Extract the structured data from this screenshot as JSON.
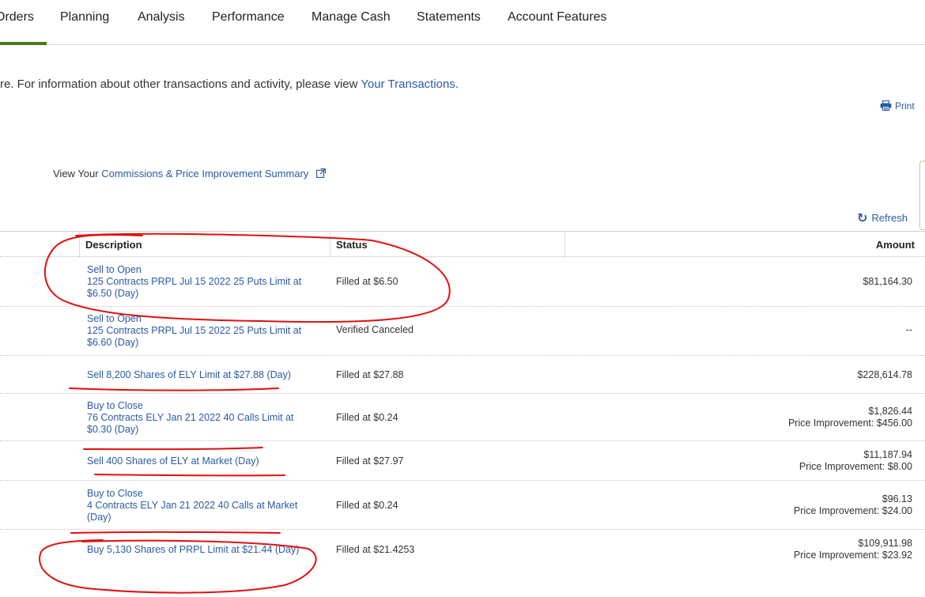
{
  "nav": {
    "items": [
      "Orders",
      "Planning",
      "Analysis",
      "Performance",
      "Manage Cash",
      "Statements",
      "Account Features"
    ],
    "active": "Orders"
  },
  "info": {
    "text": "re. For information about other transactions and activity, please view ",
    "link": "Your Transactions."
  },
  "print_label": "Print",
  "commissions": {
    "prefix": "View Your ",
    "link": "Commissions & Price Improvement Summary"
  },
  "refresh_label": "Refresh",
  "table": {
    "headers": {
      "description": "Description",
      "status": "Status",
      "amount": "Amount"
    },
    "rows": [
      {
        "desc": [
          "Sell to Open",
          "125 Contracts PRPL Jul 15 2022 25 Puts Limit at",
          "$6.50 (Day)"
        ],
        "status": "Filled at $6.50",
        "amount": "$81,164.30",
        "price_improvement": ""
      },
      {
        "desc": [
          "Sell to Open",
          "125 Contracts PRPL Jul 15 2022 25 Puts Limit at",
          "$6.60 (Day)"
        ],
        "status": "Verified Canceled",
        "amount": "--",
        "price_improvement": ""
      },
      {
        "desc": [
          "Sell 8,200 Shares of ELY Limit at $27.88 (Day)"
        ],
        "status": "Filled at $27.88",
        "amount": "$228,614.78",
        "price_improvement": ""
      },
      {
        "desc": [
          "Buy to Close",
          "76 Contracts ELY Jan 21 2022 40 Calls Limit at",
          "$0.30 (Day)"
        ],
        "status": "Filled at $0.24",
        "amount": "$1,826.44",
        "price_improvement": "Price Improvement: $456.00"
      },
      {
        "desc": [
          "Sell 400 Shares of ELY at Market (Day)"
        ],
        "status": "Filled at $27.97",
        "amount": "$11,187.94",
        "price_improvement": "Price Improvement: $8.00"
      },
      {
        "desc": [
          "Buy to Close",
          "4 Contracts ELY Jan 21 2022 40 Calls at Market",
          "(Day)"
        ],
        "status": "Filled at $0.24",
        "amount": "$96.13",
        "price_improvement": "Price Improvement: $24.00"
      },
      {
        "desc": [
          "Buy 5,130 Shares of PRPL Limit at $21.44 (Day)"
        ],
        "status": "Filled at $21.4253",
        "amount": "$109,911.98",
        "price_improvement": "Price Improvement: $23.92"
      }
    ]
  },
  "colors": {
    "link": "#2a5aa6",
    "active_tab": "#4a7a1a",
    "annotation": "#e01010"
  },
  "icons": [
    "printer-icon",
    "external-link-icon",
    "refresh-icon"
  ]
}
